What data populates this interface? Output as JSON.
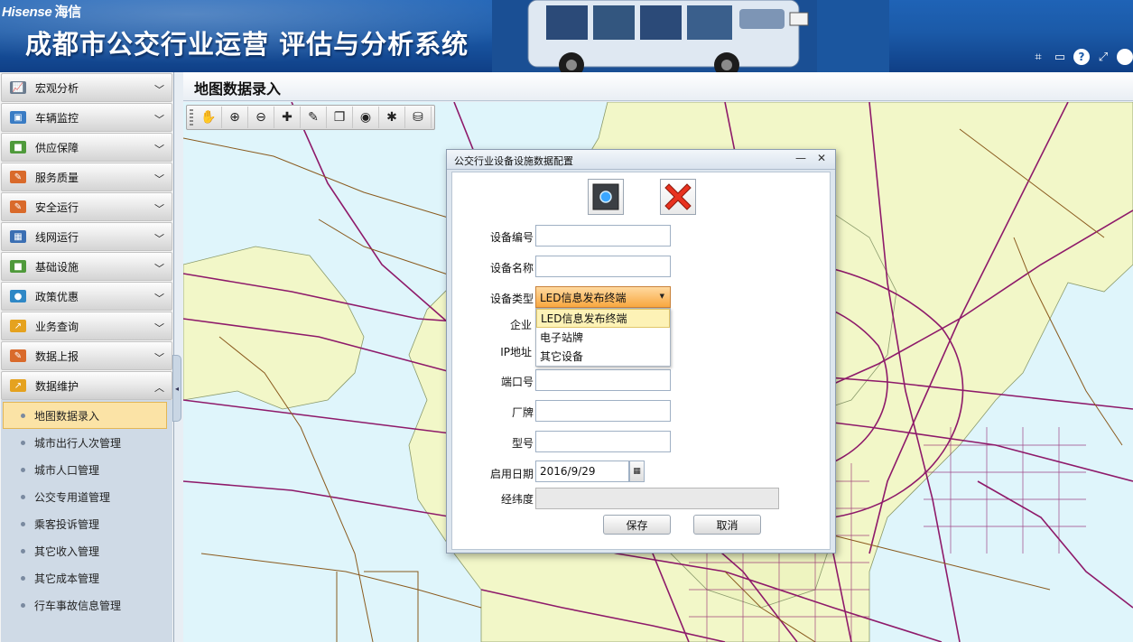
{
  "header": {
    "brand_en": "Hisense",
    "brand_cn": "海信",
    "system_title": "成都市公交行业运营 评估与分析系统",
    "tools": [
      "crop-icon",
      "minimize-icon",
      "help-icon",
      "fullscreen-icon",
      "power-icon"
    ],
    "help_glyph": "?"
  },
  "sidebar": {
    "items": [
      {
        "label": "宏观分析",
        "icon": "chart-line-icon",
        "color": "#6b7c8f"
      },
      {
        "label": "车辆监控",
        "icon": "monitor-icon",
        "color": "#3a7cc4"
      },
      {
        "label": "供应保障",
        "icon": "truck-icon",
        "color": "#4f9a3b"
      },
      {
        "label": "服务质量",
        "icon": "pencil-icon",
        "color": "#d96a2b"
      },
      {
        "label": "安全运行",
        "icon": "pencil-icon",
        "color": "#d96a2b"
      },
      {
        "label": "线网运行",
        "icon": "grid-icon",
        "color": "#3b6fb3"
      },
      {
        "label": "基础设施",
        "icon": "truck-icon",
        "color": "#4f9a3b"
      },
      {
        "label": "政策优惠",
        "icon": "globe-icon",
        "color": "#2f88c6"
      },
      {
        "label": "业务查询",
        "icon": "trend-icon",
        "color": "#e5a21f"
      },
      {
        "label": "数据上报",
        "icon": "pencil-icon",
        "color": "#d96a2b"
      },
      {
        "label": "数据维护",
        "icon": "trend-icon",
        "color": "#e5a21f"
      }
    ],
    "sub_items": [
      "地图数据录入",
      "城市出行人次管理",
      "城市人口管理",
      "公交专用道管理",
      "乘客投诉管理",
      "其它收入管理",
      "其它成本管理",
      "行车事故信息管理"
    ],
    "active_sub": "地图数据录入"
  },
  "main": {
    "page_title": "地图数据录入",
    "toolbar": [
      "pan-hand-icon",
      "zoom-in-icon",
      "zoom-out-icon",
      "add-point-icon",
      "edit-icon",
      "layers-icon",
      "marker-icon",
      "clear-icon",
      "database-icon"
    ]
  },
  "dialog": {
    "title": "公交行业设备设施数据配置",
    "fields": {
      "device_no_label": "设备编号",
      "device_name_label": "设备名称",
      "device_type_label": "设备类型",
      "company_label": "企业",
      "ip_label": "IP地址",
      "port_label": "端口号",
      "brand_label": "厂牌",
      "model_label": "型号",
      "start_date_label": "启用日期",
      "latlng_label": "经纬度"
    },
    "device_type_value": "LED信息发布终端",
    "device_type_options": [
      "LED信息发布终端",
      "电子站牌",
      "其它设备"
    ],
    "start_date_value": "2016/9/29",
    "save_label": "保存",
    "cancel_label": "取消"
  },
  "colors": {
    "header_blue": "#1b5aa8",
    "map_water": "#dff5fb",
    "map_land": "#f2f7c8",
    "road_purple": "#8e1a6a",
    "road_brown": "#8a5a1e"
  }
}
